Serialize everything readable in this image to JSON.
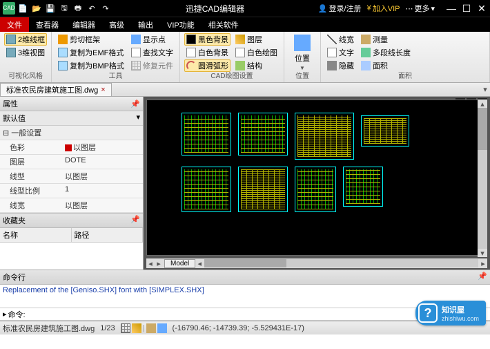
{
  "titlebar": {
    "app_title": "迅捷CAD编辑器",
    "login": "登录/注册",
    "vip": "加入VIP",
    "more": "更多"
  },
  "tabs": [
    "文件",
    "查看器",
    "编辑器",
    "高级",
    "输出",
    "VIP功能",
    "相关软件"
  ],
  "active_tab_index": 0,
  "ribbon": {
    "g1": {
      "b1": "2维线框",
      "b2": "3维视图",
      "label": "可视化风格"
    },
    "g2": {
      "b1": "剪切框架",
      "b2": "复制为EMF格式",
      "b3": "复制为BMP格式",
      "c1": "显示点",
      "c2": "查找文字",
      "c3": "修复元件",
      "label": "工具"
    },
    "g3": {
      "b1": "黑色背景",
      "b2": "白色背景",
      "b3": "圆滑弧形",
      "c1": "图层",
      "c2": "白色绘图",
      "c3": "结构",
      "label": "CAD绘图设置"
    },
    "g4": {
      "big": "位置",
      "label": "位置"
    },
    "g5": {
      "b1": "线宽",
      "b2": "文字",
      "b3": "隐藏",
      "c1": "测量",
      "c2": "多段线长度",
      "c3": "面积",
      "label": "面积"
    }
  },
  "filetab": {
    "name": "标准农民房建筑施工图.dwg"
  },
  "props": {
    "panel_title": "属性",
    "default_label": "默认值",
    "section": "一般设置",
    "rows": [
      {
        "k": "色彩",
        "v": "以图层",
        "swatch": true
      },
      {
        "k": "图层",
        "v": "DOTE"
      },
      {
        "k": "线型",
        "v": "以图层"
      },
      {
        "k": "线型比例",
        "v": "1"
      },
      {
        "k": "线宽",
        "v": "以图层"
      }
    ],
    "fav_title": "收藏夹",
    "fav_cols": [
      "名称",
      "路径"
    ]
  },
  "model_tab": "Model",
  "cmd": {
    "header": "命令行",
    "log": "Replacement of the [Geniso.SHX] font with [SIMPLEX.SHX]",
    "prompt_label": "命令:"
  },
  "status": {
    "file": "标准农民房建筑施工图.dwg",
    "page": "1/23",
    "coords": "(-16790.46; -14739.39; -5.529431E-17)"
  },
  "watermark": {
    "name": "知识屋",
    "url": "zhishiwu.com"
  }
}
